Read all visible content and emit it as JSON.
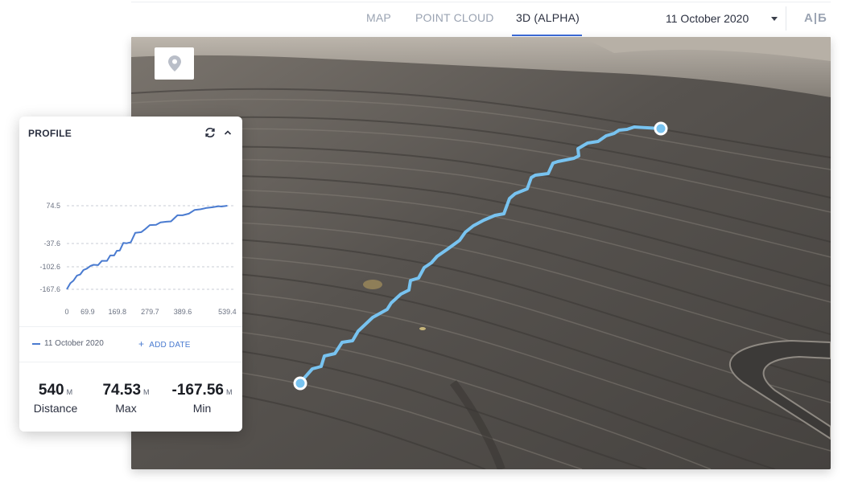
{
  "tabs": [
    {
      "label": "MAP",
      "active": false
    },
    {
      "label": "POINT CLOUD",
      "active": false
    },
    {
      "label": "3D (ALPHA)",
      "active": true
    }
  ],
  "date_select": {
    "value": "11 October 2020"
  },
  "language_toggle": "А|Б",
  "profile": {
    "title": "PROFILE",
    "legend": {
      "date": "11 October 2020",
      "add_date_label": "ADD DATE"
    },
    "stats": [
      {
        "value": "540",
        "unit": "M",
        "label": "Distance"
      },
      {
        "value": "74.53",
        "unit": "M",
        "label": "Max"
      },
      {
        "value": "-167.56",
        "unit": "M",
        "label": "Min"
      }
    ]
  },
  "chart_data": {
    "type": "line",
    "y_ticks": [
      74.5,
      -37.6,
      -102.6,
      -167.6
    ],
    "x_ticks": [
      0,
      69.9,
      169.8,
      279.7,
      389.6,
      539.4
    ],
    "xlim": [
      0,
      560
    ],
    "grid": true,
    "series": [
      {
        "color": "#4a7bd0",
        "x": [
          0,
          12,
          22,
          34,
          45,
          56,
          67,
          80,
          90,
          105,
          118,
          135,
          146,
          159,
          168,
          178,
          190,
          201,
          215,
          230,
          250,
          262,
          279,
          300,
          315,
          335,
          350,
          372,
          389,
          410,
          430,
          450,
          470,
          490,
          510,
          520,
          539.4
        ],
        "y": [
          -167.6,
          -150,
          -143,
          -128,
          -125,
          -112,
          -108,
          -100,
          -97,
          -98,
          -86,
          -86,
          -71,
          -71,
          -58,
          -57,
          -36,
          -37,
          -34,
          -6,
          -4,
          4,
          17,
          18,
          25,
          27,
          28,
          46,
          46,
          51,
          62,
          64,
          68,
          70,
          73,
          72,
          74.5
        ]
      }
    ]
  }
}
